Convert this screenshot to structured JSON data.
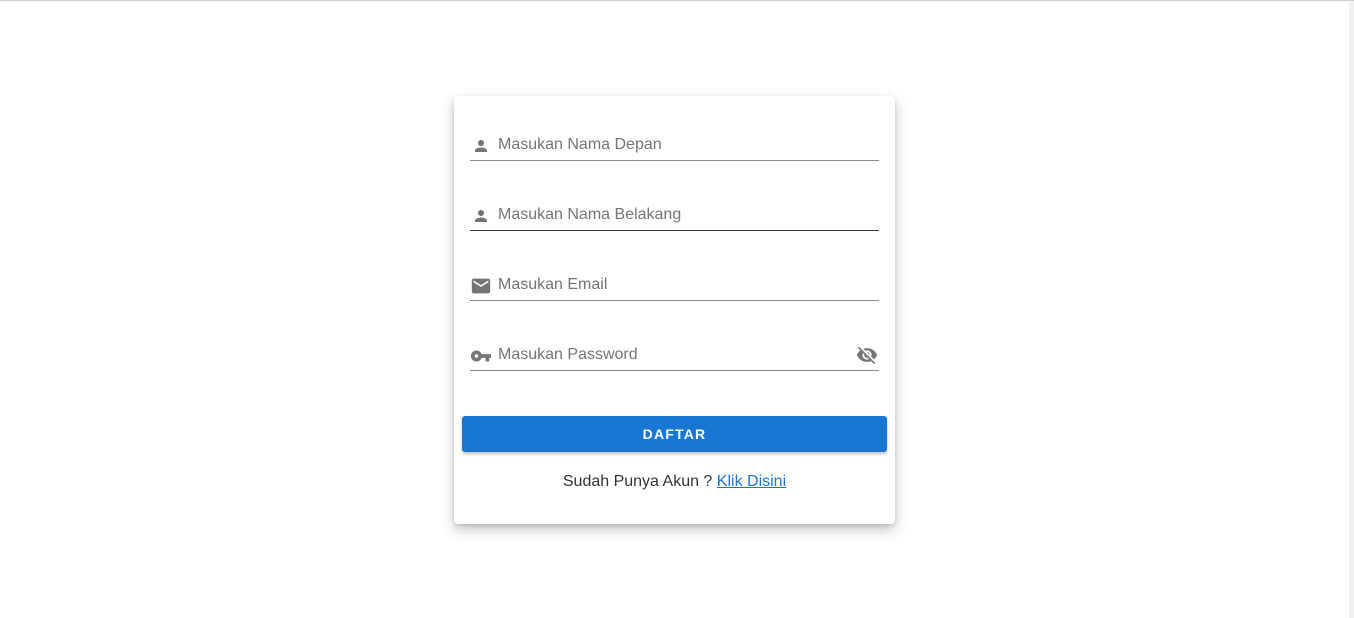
{
  "form": {
    "first_name": {
      "placeholder": "Masukan Nama Depan",
      "value": "",
      "icon": "person-icon"
    },
    "last_name": {
      "placeholder": "Masukan Nama Belakang",
      "value": "",
      "icon": "person-icon"
    },
    "email": {
      "placeholder": "Masukan Email",
      "value": "",
      "icon": "mail-icon"
    },
    "password": {
      "placeholder": "Masukan Password",
      "value": "",
      "icon": "key-icon",
      "toggle_icon": "eye-off-icon"
    },
    "submit_label": "DAFTAR",
    "footer_text": "Sudah Punya Akun ?",
    "login_link_label": "Klik Disini"
  },
  "colors": {
    "primary": "#1976d2",
    "icon": "#757575",
    "text": "#333333"
  }
}
